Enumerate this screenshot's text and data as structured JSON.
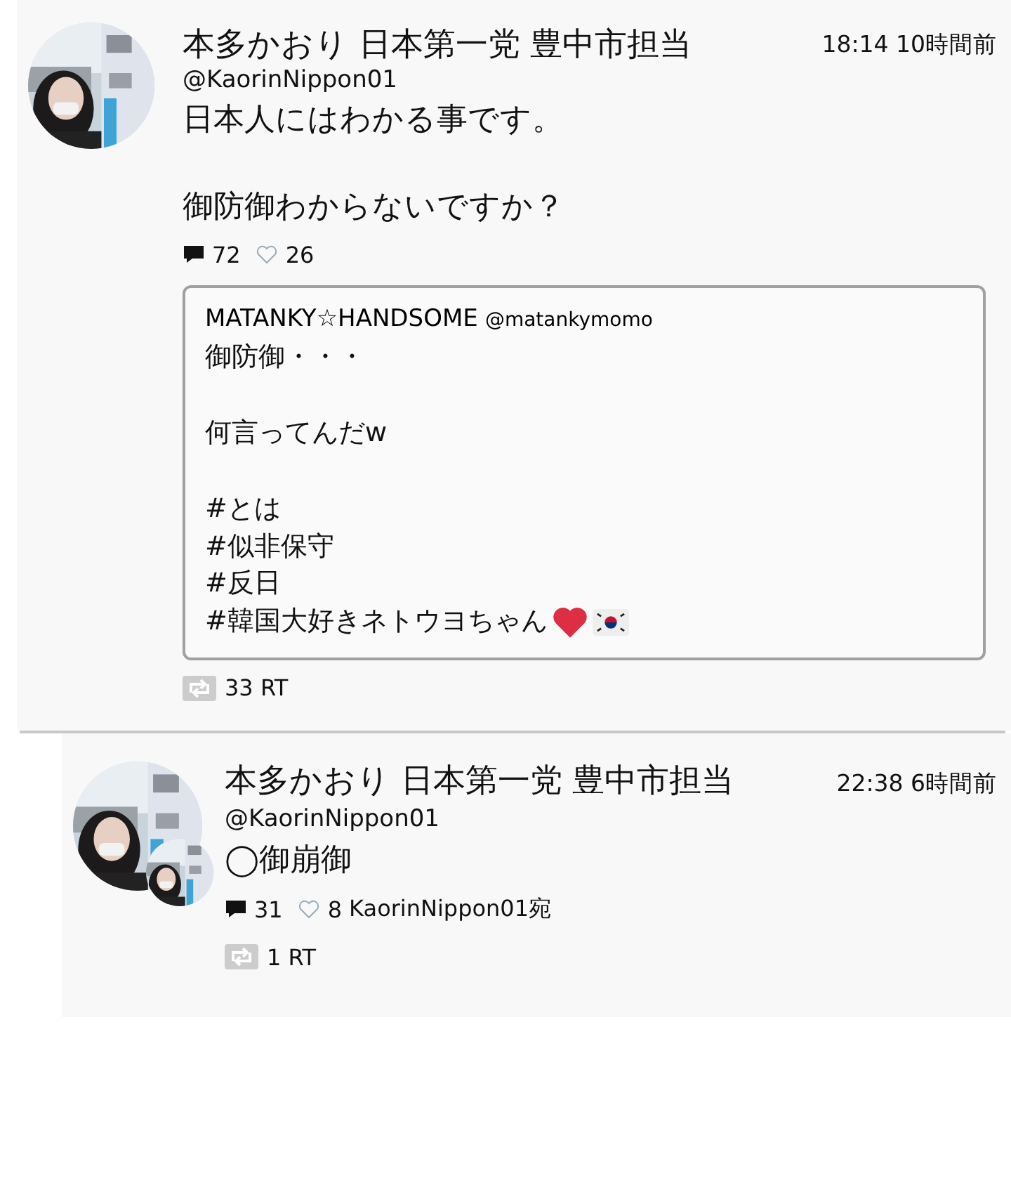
{
  "posts": [
    {
      "author": "本多かおり 日本第一党 豊中市担当",
      "handle": "@KaorinNippon01",
      "time": "18:14 10時間前",
      "avatar": {
        "kind": "picture"
      },
      "paragraphs": [
        [
          "日本人にはわかる事です。"
        ],
        [
          "御防御わからないですか？"
        ]
      ],
      "replies": "72",
      "likes": "26",
      "quote": {
        "author": "MATANKY☆HANDSOME",
        "handle": "@matankymomo",
        "paragraphs": [
          [
            "御防御・・・"
          ],
          [
            "何言ってんだw"
          ],
          [
            "#とは",
            "#似非保守",
            "#反日",
            "#韓国大好きネトウヨちゃん"
          ]
        ],
        "heart": true,
        "flag": true
      },
      "retweets": "33 RT",
      "nested": false
    },
    {
      "author": "本多かおり 日本第一党 豊中市担当",
      "handle": "@KaorinNippon01",
      "time": "22:38 6時間前",
      "avatar": {
        "kind": "picture"
      },
      "overlay_avatar": true,
      "paragraphs": [
        [
          "◯御崩御"
        ]
      ],
      "replies": "31",
      "likes": "8",
      "reply_to": "KaorinNippon01宛",
      "retweets": "1 RT",
      "nested": true
    }
  ]
}
